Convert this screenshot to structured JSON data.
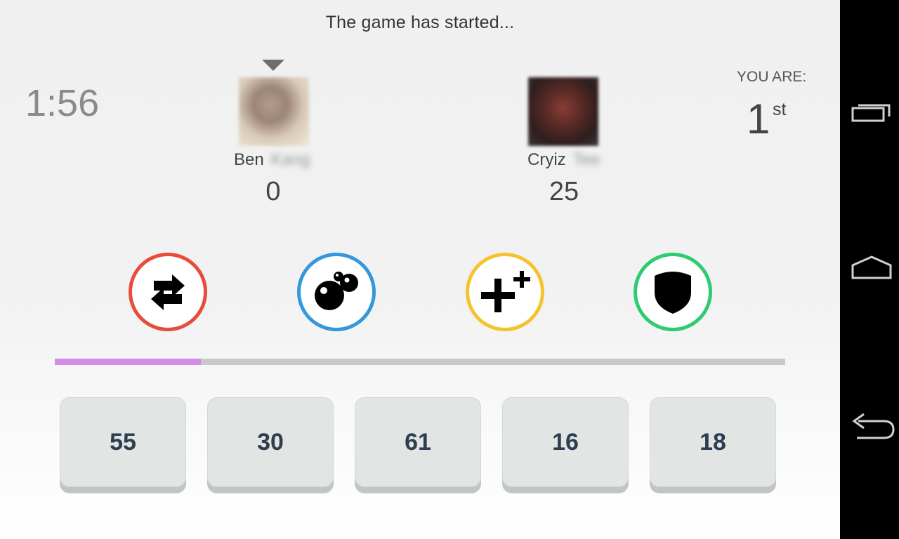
{
  "status": {
    "text": "The game has started..."
  },
  "timer": {
    "value": "1:56"
  },
  "players": [
    {
      "first_name": "Ben",
      "last_name_obscured": "Kang",
      "score": "0",
      "active_turn": true
    },
    {
      "first_name": "Cryiz",
      "last_name_obscured": "Tee",
      "score": "25",
      "active_turn": false
    }
  ],
  "rank": {
    "label": "YOU ARE:",
    "value": "1",
    "suffix": "st"
  },
  "powerups": [
    {
      "name": "swap",
      "icon": "swap-arrows-icon",
      "ring_color": "#e74c3c"
    },
    {
      "name": "bomb",
      "icon": "bubbles-icon",
      "ring_color": "#3498db"
    },
    {
      "name": "bonus",
      "icon": "plus-plus-icon",
      "ring_color": "#f4c430"
    },
    {
      "name": "shield",
      "icon": "shield-icon",
      "ring_color": "#2ecc71"
    }
  ],
  "progress": {
    "fraction": 0.2,
    "fill_color": "#d48be6",
    "track_color": "#c8c8c8"
  },
  "number_keys": [
    "55",
    "30",
    "61",
    "16",
    "18"
  ],
  "navbar": {
    "icons": [
      "recent-apps-icon",
      "home-icon",
      "back-icon"
    ]
  }
}
